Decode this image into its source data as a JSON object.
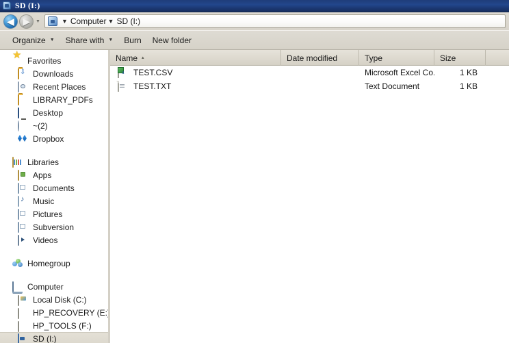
{
  "window": {
    "title": "SD (I:)",
    "title_icon": "sd-card-icon"
  },
  "addressbar": {
    "back_button": "◀",
    "forward_button": "▶",
    "history_caret": "▼",
    "crumb_icon": "sd-card-icon",
    "separator": "▼",
    "crumbs": [
      {
        "label": "Computer"
      },
      {
        "label": "SD (I:)"
      }
    ]
  },
  "toolbar": {
    "items": [
      {
        "label": "Organize",
        "caret": "▼"
      },
      {
        "label": "Share with",
        "caret": "▼"
      },
      {
        "label": "Burn",
        "caret": ""
      },
      {
        "label": "New folder",
        "caret": ""
      }
    ]
  },
  "sidebar": {
    "groups": [
      {
        "header": {
          "label": "Favorites",
          "icon": "star-icon"
        },
        "items": [
          {
            "label": "Downloads",
            "icon": "downloads-folder-icon"
          },
          {
            "label": "Recent Places",
            "icon": "recent-places-icon"
          },
          {
            "label": "LIBRARY_PDFs",
            "icon": "folder-icon"
          },
          {
            "label": "Desktop",
            "icon": "desktop-monitor-icon"
          },
          {
            "label": "~(2)",
            "icon": "globe-icon"
          },
          {
            "label": "Dropbox",
            "icon": "dropbox-icon"
          }
        ]
      },
      {
        "header": {
          "label": "Libraries",
          "icon": "libraries-icon"
        },
        "items": [
          {
            "label": "Apps",
            "icon": "apps-library-icon"
          },
          {
            "label": "Documents",
            "icon": "documents-library-icon"
          },
          {
            "label": "Music",
            "icon": "music-library-icon"
          },
          {
            "label": "Pictures",
            "icon": "pictures-library-icon"
          },
          {
            "label": "Subversion",
            "icon": "subversion-library-icon"
          },
          {
            "label": "Videos",
            "icon": "videos-library-icon"
          }
        ]
      },
      {
        "header": {
          "label": "Homegroup",
          "icon": "homegroup-icon"
        },
        "items": []
      },
      {
        "header": {
          "label": "Computer",
          "icon": "computer-icon"
        },
        "items": [
          {
            "label": "Local Disk (C:)",
            "icon": "local-disk-icon",
            "selected": false
          },
          {
            "label": "HP_RECOVERY (E:)",
            "icon": "hard-disk-icon",
            "selected": false
          },
          {
            "label": "HP_TOOLS (F:)",
            "icon": "hard-disk-icon",
            "selected": false
          },
          {
            "label": "SD (I:)",
            "icon": "sd-card-icon",
            "selected": true
          }
        ]
      }
    ]
  },
  "filelist": {
    "columns": [
      {
        "label": "Name",
        "sort": "▴"
      },
      {
        "label": "Date modified",
        "sort": ""
      },
      {
        "label": "Type",
        "sort": ""
      },
      {
        "label": "Size",
        "sort": ""
      },
      {
        "label": "",
        "sort": ""
      }
    ],
    "rows": [
      {
        "name": "TEST.CSV",
        "date_modified": "",
        "type": "Microsoft Excel Co...",
        "size": "1 KB",
        "icon": "excel-csv-file-icon"
      },
      {
        "name": "TEST.TXT",
        "date_modified": "",
        "type": "Text Document",
        "size": "1 KB",
        "icon": "text-file-icon"
      }
    ]
  },
  "colors": {
    "titlebar_blue": "#1f3d7a",
    "chrome_beige": "#d6d2c8",
    "selection_highlight": "#e0dcd2",
    "pane_white": "#ffffff"
  }
}
